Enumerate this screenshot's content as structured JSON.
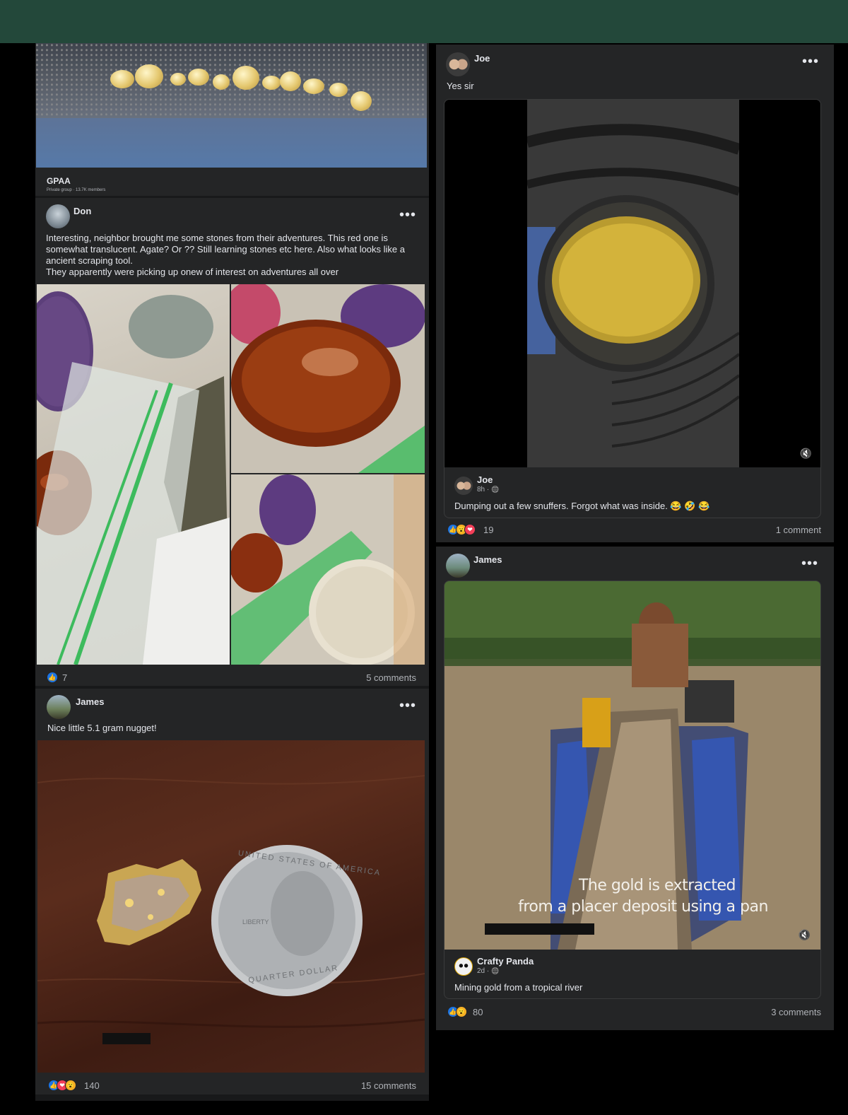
{
  "group_card": {
    "name": "GPAA",
    "meta": "Private group · 13.7K members"
  },
  "post_don": {
    "author": "Don",
    "text_lines": [
      "Interesting, neighbor brought me some stones from their adventures. This red one is",
      "somewhat translucent. Agate? Or ?? Still learning stones etc here. Also what looks like a",
      "ancient scraping tool.",
      "They apparently were picking up onew of interest on adventures all over"
    ],
    "reaction_count": "7",
    "comments": "5 comments"
  },
  "post_james_nugget": {
    "author": "James",
    "text": "Nice little 5.1 gram nugget!",
    "coin_text": "UNITED STATES OF AMERICA",
    "coin_bottom": "QUARTER DOLLAR",
    "coin_liberty": "LIBERTY",
    "reaction_count": "140",
    "comments": "15 comments"
  },
  "post_joe": {
    "author": "Joe",
    "text": "Yes sir",
    "shared": {
      "author": "Joe",
      "time": "8h · ",
      "text": "Dumping out a few snuffers. Forgot what was inside. 😂 🤣 😂"
    },
    "reaction_count": "19",
    "comments": "1 comment"
  },
  "post_james_river": {
    "author": "James",
    "caption_line1": "The gold is extracted",
    "caption_line2": "from a placer deposit using a pan",
    "shared": {
      "author": "Crafty Panda",
      "time": "2d · ",
      "text": "Mining gold from a tropical river"
    },
    "reaction_count": "80",
    "comments": "3 comments"
  },
  "icons": {
    "more": "•••",
    "mute": "🔇",
    "globe": "🌐",
    "like": "👍",
    "love": "❤",
    "wow": "😮"
  },
  "colors": {
    "header": "#23483a",
    "card": "#242526",
    "like": "#1b74e4"
  }
}
